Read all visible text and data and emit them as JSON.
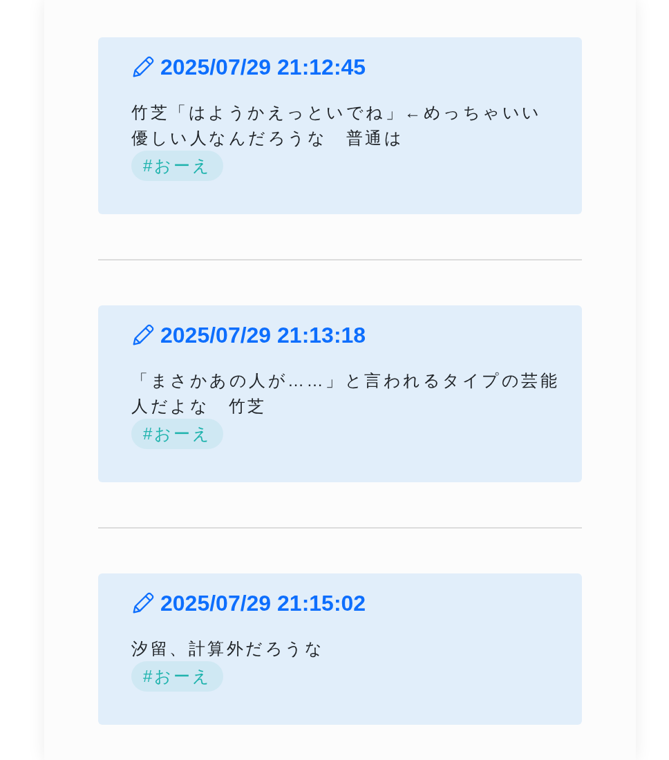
{
  "posts": [
    {
      "timestamp": "2025/07/29 21:12:45",
      "lines": [
        "竹芝「はようかえっといでね」←めっちゃいい",
        "優しい人なんだろうな　普通は"
      ],
      "tags": [
        "#おーえ"
      ]
    },
    {
      "timestamp": "2025/07/29 21:13:18",
      "lines": [
        "「まさかあの人が……」と言われるタイプの芸能人だよな　竹芝"
      ],
      "tags": [
        "#おーえ"
      ]
    },
    {
      "timestamp": "2025/07/29 21:15:02",
      "lines": [
        "汐留、計算外だろうな"
      ],
      "tags": [
        "#おーえ"
      ]
    }
  ]
}
